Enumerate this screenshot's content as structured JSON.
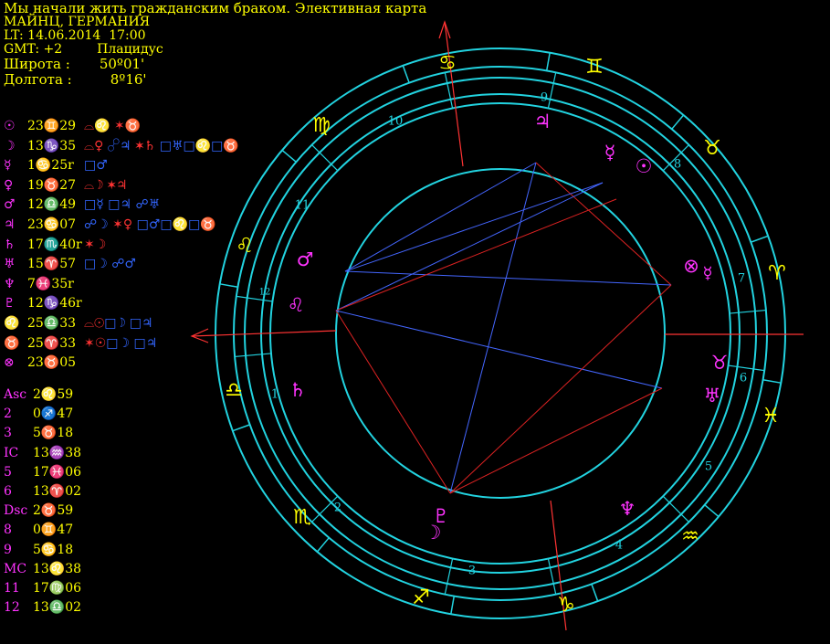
{
  "header": {
    "title": "Мы начали жить гражданским браком. Элективная карта",
    "place": "МАЙНЦ, ГЕРМАНИЯ",
    "lt": "LT: 14.06.2014  17:00",
    "gmt": "GMT: +2",
    "system": "Плацидус",
    "lat_label": "Широта :",
    "lat_value": "50º01'",
    "lon_label": "Долгота :",
    "lon_value": "8º16'"
  },
  "planets": [
    {
      "symbol": "☉",
      "position": "23♊29",
      "aspects": [
        {
          "t": "⌓♌",
          "c": "#ff3333"
        },
        {
          "t": " ✶♉",
          "c": "#ff3333"
        }
      ]
    },
    {
      "symbol": "☽",
      "position": "13♑35",
      "aspects": [
        {
          "t": "⌓♀",
          "c": "#ff3333"
        },
        {
          "t": " ☍♃",
          "c": "#3366ff"
        },
        {
          "t": " ✶♄",
          "c": "#ff3333"
        },
        {
          "t": " □♅",
          "c": "#3366ff"
        },
        {
          "t": "□♌",
          "c": "#3366ff"
        },
        {
          "t": "□♉",
          "c": "#3366ff"
        }
      ]
    },
    {
      "symbol": "☿",
      "position": "1♋25r",
      "aspects": [
        {
          "t": "□♂",
          "c": "#3366ff"
        }
      ]
    },
    {
      "symbol": "♀",
      "position": "19♉27",
      "aspects": [
        {
          "t": "⌓☽",
          "c": "#ff3333"
        },
        {
          "t": " ✶♃",
          "c": "#ff3333"
        }
      ]
    },
    {
      "symbol": "♂",
      "position": "12♎49",
      "aspects": [
        {
          "t": "□☿",
          "c": "#3366ff"
        },
        {
          "t": " □♃",
          "c": "#3366ff"
        },
        {
          "t": " ☍♅",
          "c": "#3366ff"
        }
      ]
    },
    {
      "symbol": "♃",
      "position": "23♋07",
      "aspects": [
        {
          "t": "☍☽",
          "c": "#3366ff"
        },
        {
          "t": " ✶♀",
          "c": "#ff3333"
        },
        {
          "t": " □♂",
          "c": "#3366ff"
        },
        {
          "t": "□♌",
          "c": "#3366ff"
        },
        {
          "t": "□♉",
          "c": "#3366ff"
        }
      ]
    },
    {
      "symbol": "♄",
      "position": "17♏40r",
      "aspects": [
        {
          "t": "✶☽",
          "c": "#ff3333"
        }
      ]
    },
    {
      "symbol": "♅",
      "position": "15♈57",
      "aspects": [
        {
          "t": "□☽",
          "c": "#3366ff"
        },
        {
          "t": " ☍♂",
          "c": "#3366ff"
        }
      ]
    },
    {
      "symbol": "♆",
      "position": "7♓35r",
      "aspects": []
    },
    {
      "symbol": "♇",
      "position": "12♑46r",
      "aspects": []
    },
    {
      "symbol": "♌",
      "position": "25♎33",
      "aspects": [
        {
          "t": "⌓☉",
          "c": "#ff3333"
        },
        {
          "t": "□☽",
          "c": "#3366ff"
        },
        {
          "t": " □♃",
          "c": "#3366ff"
        }
      ]
    },
    {
      "symbol": "♉",
      "position": "25♈33",
      "aspects": [
        {
          "t": "✶☉",
          "c": "#ff3333"
        },
        {
          "t": "□☽",
          "c": "#3366ff"
        },
        {
          "t": " □♃",
          "c": "#3366ff"
        }
      ]
    },
    {
      "symbol": "⊗",
      "position": "23♉05",
      "aspects": []
    }
  ],
  "houses": [
    {
      "label": "Asc",
      "value": "2♌59"
    },
    {
      "label": "2",
      "value": "0♐47"
    },
    {
      "label": "3",
      "value": "5♉18"
    },
    {
      "label": "IC",
      "value": "13♒38"
    },
    {
      "label": "5",
      "value": "17♓06"
    },
    {
      "label": "6",
      "value": "13♈02"
    },
    {
      "label": "Dsc",
      "value": "2♉59"
    },
    {
      "label": "8",
      "value": "0♊47"
    },
    {
      "label": "9",
      "value": "5♋18"
    },
    {
      "label": "MC",
      "value": "13♌38"
    },
    {
      "label": "11",
      "value": "17♍06"
    },
    {
      "label": "12",
      "value": "13♎02"
    }
  ],
  "wheel": {
    "zodiac_signs": [
      "♋",
      "♊",
      "♉",
      "♈",
      "♓",
      "♒",
      "♑",
      "♐",
      "♏",
      "♎",
      "♌",
      "♍"
    ],
    "house_numbers": [
      "1",
      "2",
      "3",
      "4",
      "5",
      "6",
      "7",
      "8",
      "9",
      "10",
      "11",
      "12"
    ],
    "chart_planets": [
      "♃",
      "☿",
      "☉",
      "⊗",
      "♉",
      "♅",
      "♆",
      "♇",
      "☽",
      "♄",
      "♌",
      "♂"
    ],
    "colors": {
      "ring": "#22d3e0",
      "sign": "#ffff00",
      "planet": "#ff33ff",
      "axis": "#ff3333",
      "aspect_blue": "#4466ff",
      "aspect_red": "#dd2222"
    }
  }
}
